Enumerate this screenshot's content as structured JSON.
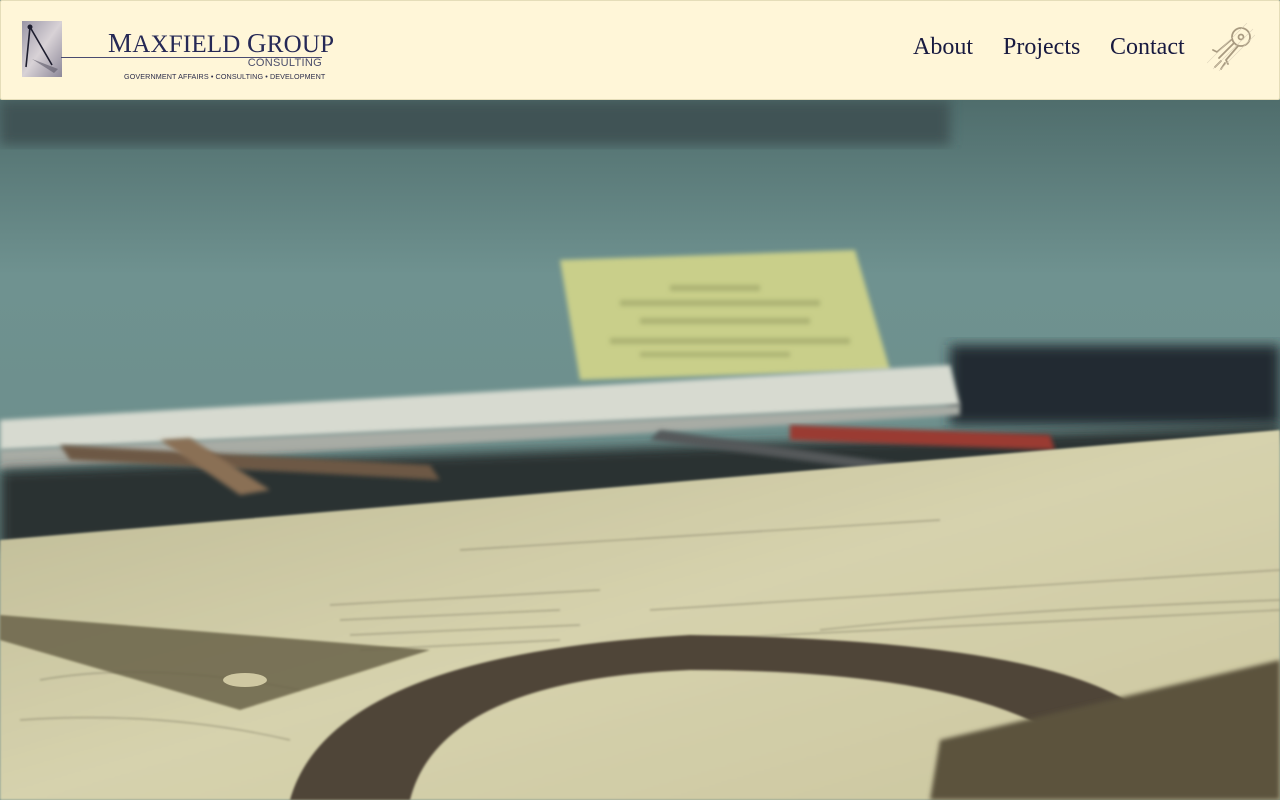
{
  "logo": {
    "title_initial_1": "M",
    "title_rest_1": "AXFIELD",
    "title_initial_2": "G",
    "title_rest_2": "ROUP",
    "subtitle": "CONSULTING",
    "tagline": "GOVERNMENT AFFAIRS  •  CONSULTING  •  DEVELOPMENT",
    "icon": "drafting-compass-icon"
  },
  "nav": {
    "items": [
      {
        "label": "About"
      },
      {
        "label": "Projects"
      },
      {
        "label": "Contact"
      }
    ],
    "menu_icon": "rocket-icon"
  },
  "colors": {
    "header_bg": "#fff6d8",
    "nav_text": "#181a40",
    "brand_navy": "#262956",
    "hero_wall": "#6e8b87"
  }
}
